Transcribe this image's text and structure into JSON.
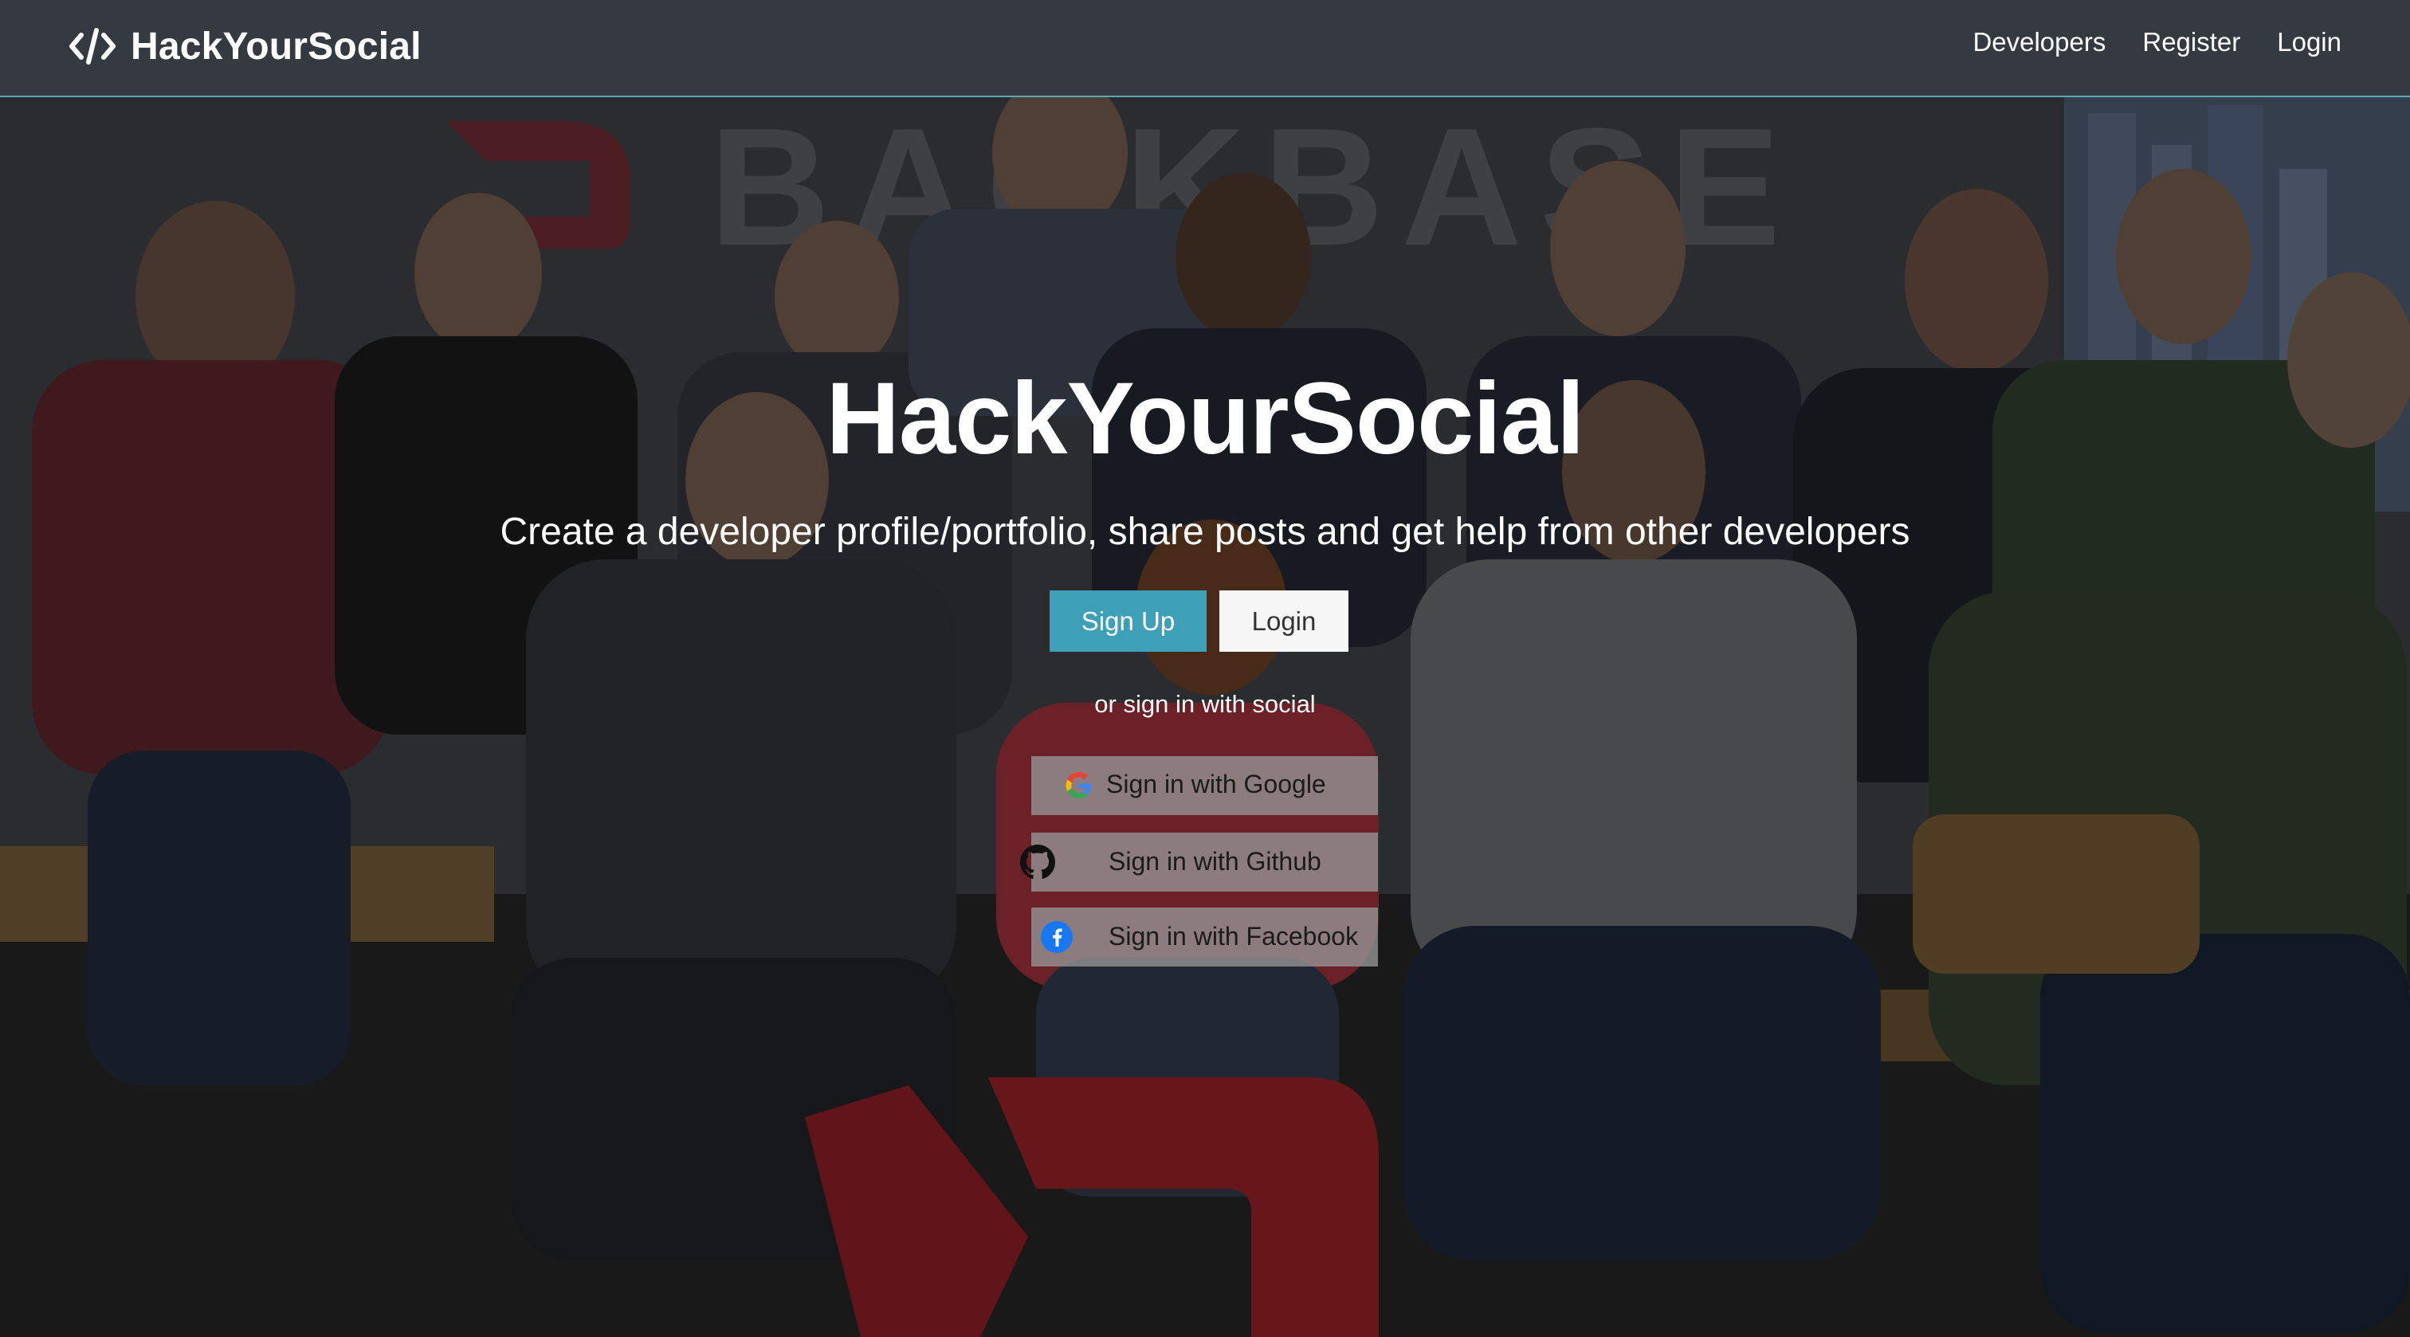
{
  "navbar": {
    "brand": "HackYourSocial",
    "brand_icon": "code-icon",
    "links": [
      {
        "label": "Developers"
      },
      {
        "label": "Register"
      },
      {
        "label": "Login"
      }
    ]
  },
  "hero": {
    "title": "HackYourSocial",
    "subtitle": "Create a developer profile/portfolio, share posts and get help from other developers",
    "signup_label": "Sign Up",
    "login_label": "Login",
    "social_label": "or sign in with social",
    "social": [
      {
        "label": "Sign in with Google",
        "icon": "google-icon"
      },
      {
        "label": "Sign in with Github",
        "icon": "github-icon"
      },
      {
        "label": "Sign in with Facebook",
        "icon": "facebook-icon"
      }
    ]
  },
  "colors": {
    "navbar_bg": "#343a40",
    "accent": "#3ea0b7",
    "nav_border": "#5aa8b8",
    "brand_red": "#c4262e"
  }
}
